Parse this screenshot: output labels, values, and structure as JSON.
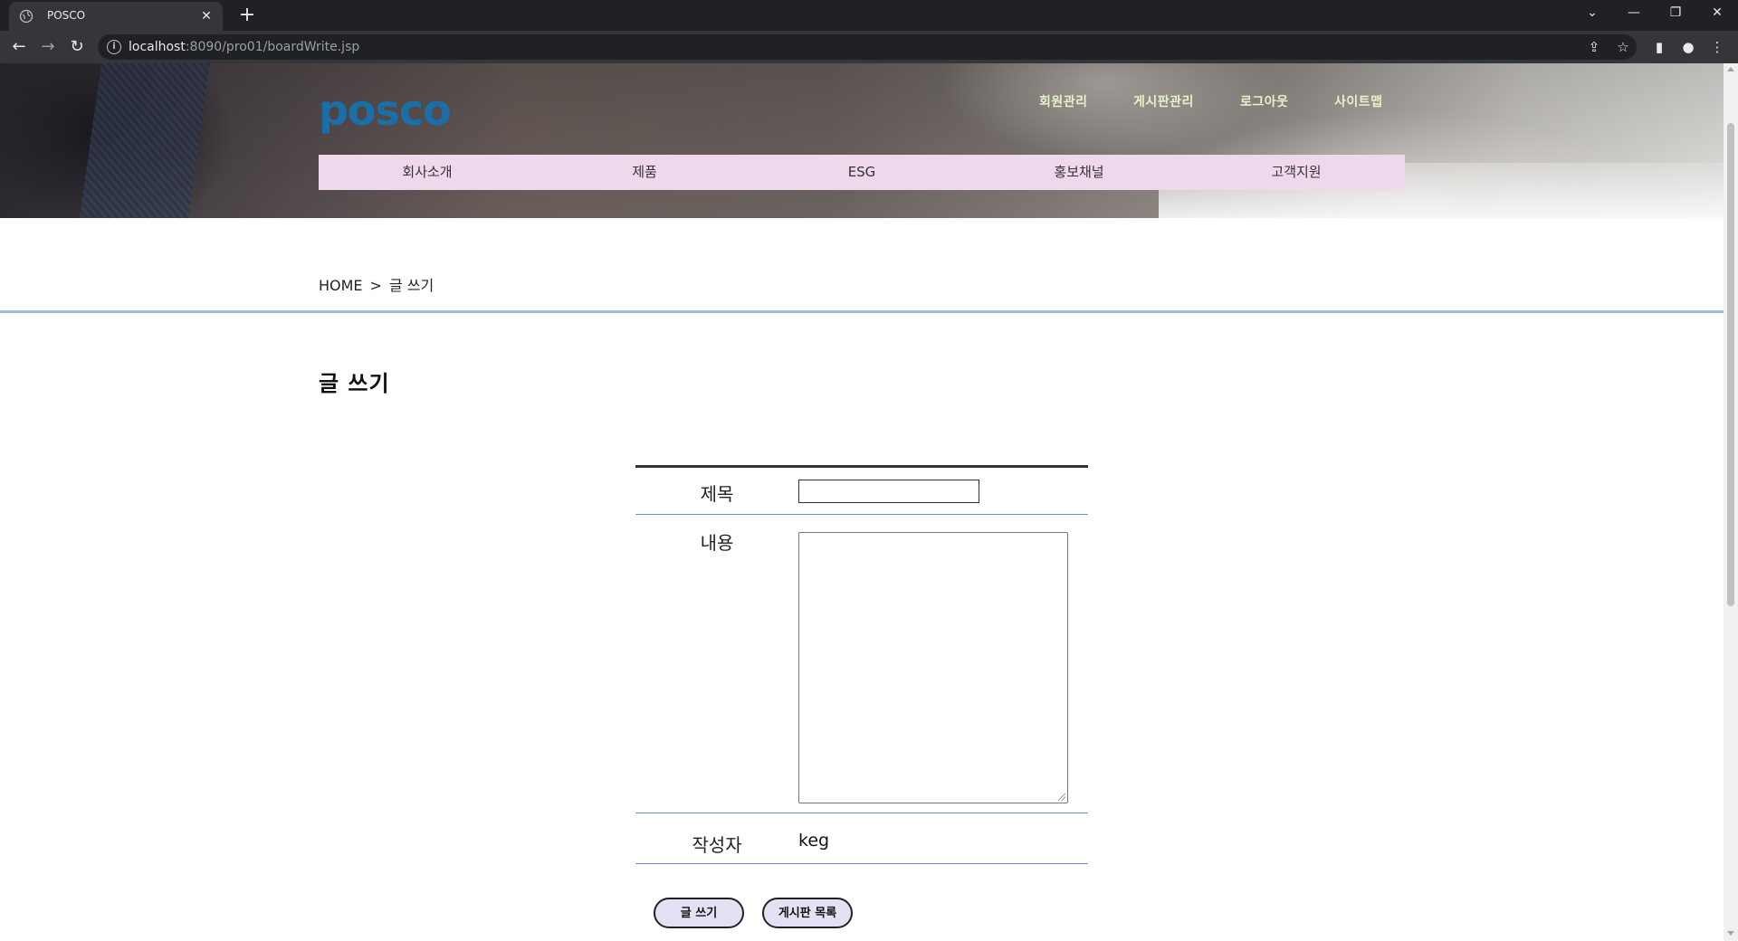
{
  "browser": {
    "tab_title": "POSCO",
    "url_host": "localhost",
    "url_rest": ":8090/pro01/boardWrite.jsp"
  },
  "header": {
    "logo_text": "posco",
    "top_menu": [
      "회원관리",
      "게시판관리",
      "로그아웃",
      "사이트맵"
    ],
    "gnb": [
      "회사소개",
      "제품",
      "ESG",
      "홍보채널",
      "고객지원"
    ],
    "colors": {
      "gnb_bg": "#efd8ec",
      "logo": "#1a6fa8",
      "top_menu": "#e8f2c8"
    }
  },
  "breadcrumb": {
    "home": "HOME",
    "sep": ">",
    "current": "글 쓰기"
  },
  "page": {
    "title": "글 쓰기"
  },
  "form": {
    "title_label": "제목",
    "title_value": "",
    "content_label": "내용",
    "content_value": "",
    "author_label": "작성자",
    "author_value": "keg",
    "submit_label": "글 쓰기",
    "list_label": "게시판 목록"
  }
}
